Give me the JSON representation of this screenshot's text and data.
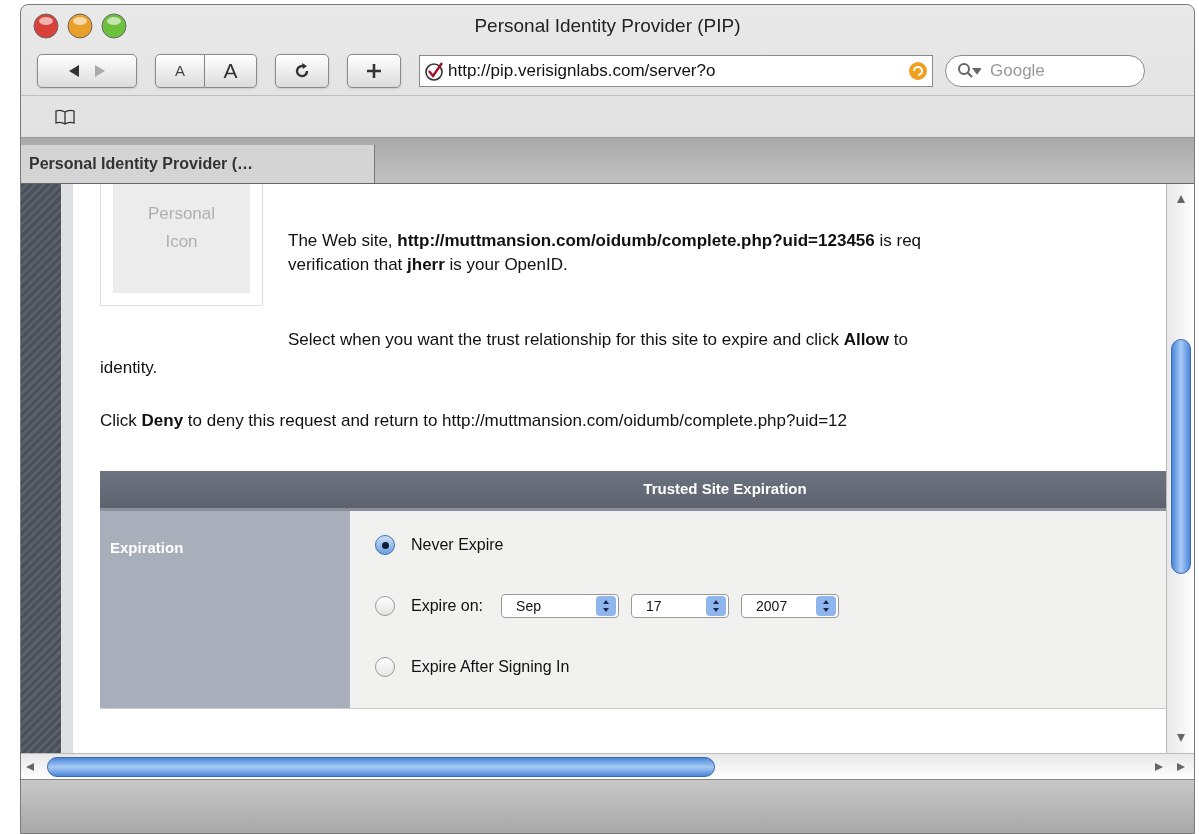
{
  "window": {
    "title": "Personal Identity Provider (PIP)"
  },
  "toolbar": {
    "text_size_small": "A",
    "text_size_large": "A",
    "address": "http://pip.verisignlabs.com/server?o",
    "search_placeholder": "Google"
  },
  "tab": {
    "label": "Personal Identity Provider (…",
    "selected": true
  },
  "personal_icon": {
    "label": "Personal Icon"
  },
  "intro_lines": [
    "The Web site, **http://muttmansion.com/oidumb/complete.php?uid=123456** is req",
    "verification that **jherr** is your OpenID."
  ],
  "select_lines": [
    "Select when you want the trust relationship for this site to expire and click **Allow** to",
    "identity."
  ],
  "deny_line": "Click **Deny** to deny this request and return to http://muttmansion.com/oidumb/complete.php?uid=12",
  "table": {
    "header": "Trusted Site Expiration",
    "row_label": "Expiration",
    "options": [
      {
        "kind": "plain",
        "label": "Never Expire",
        "selected": true
      },
      {
        "kind": "date",
        "label": "Expire on:",
        "selected": false,
        "month": "Sep",
        "day": "17",
        "year": "2007"
      },
      {
        "kind": "plain",
        "label": "Expire After Signing In",
        "selected": false
      }
    ]
  }
}
